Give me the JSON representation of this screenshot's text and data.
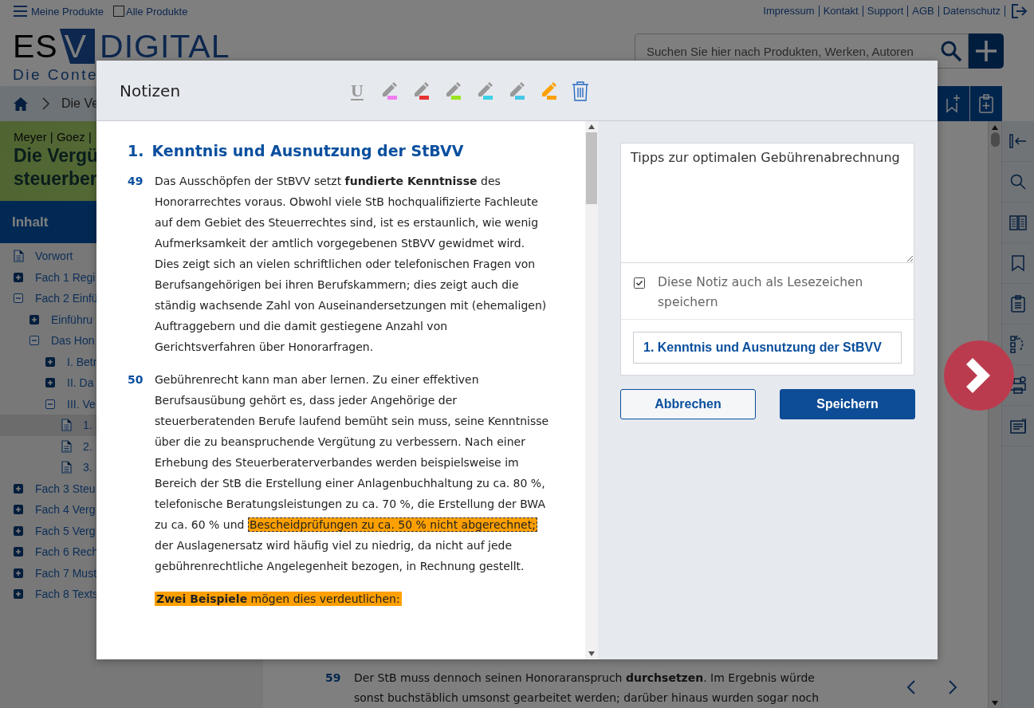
{
  "top_bar": {
    "menu_label": "Meine Produkte",
    "all_products": {
      "label": "Alle Produkte",
      "checked": false
    },
    "links": [
      "Impressum",
      "Kontakt",
      "Support",
      "AGB",
      "Datenschutz"
    ]
  },
  "logo": {
    "left": "ES",
    "mark": "V",
    "right": "DIGITAL",
    "tagline": "Die Conte"
  },
  "search": {
    "placeholder": "Suchen Sie hier nach Produkten, Werken, Autoren"
  },
  "breadcrumb": [
    "Die Ve"
  ],
  "book": {
    "authors": "Meyer | Goez |",
    "title_lines": [
      "Die Vergü",
      "steuerber"
    ]
  },
  "toc": {
    "title": "Inhalt",
    "items": [
      {
        "kind": "doc",
        "label": "Vorwort",
        "selected": false
      },
      {
        "kind": "folder",
        "label": "Fach 1 Regi",
        "expanded": false,
        "selected": false
      },
      {
        "kind": "folder",
        "label": "Fach 2 Einfü",
        "expanded": true,
        "selected": false,
        "children": [
          {
            "kind": "folder",
            "label": "Einführu",
            "expanded": false,
            "selected": false
          },
          {
            "kind": "folder",
            "label": "Das Hon",
            "expanded": true,
            "selected": false,
            "children": [
              {
                "kind": "folder",
                "label": "I. Betr",
                "expanded": false,
                "selected": false
              },
              {
                "kind": "folder",
                "label": "II. Da",
                "expanded": false,
                "selected": false
              },
              {
                "kind": "folder",
                "label": "III. Ve",
                "expanded": true,
                "selected": false,
                "children": [
                  {
                    "kind": "doc",
                    "label": "1.",
                    "selected": true
                  },
                  {
                    "kind": "doc",
                    "label": "2.",
                    "selected": false
                  },
                  {
                    "kind": "doc",
                    "label": "3.",
                    "selected": false
                  }
                ]
              }
            ]
          }
        ]
      },
      {
        "kind": "folder",
        "label": "Fach 3 Steu",
        "expanded": false,
        "selected": false
      },
      {
        "kind": "folder",
        "label": "Fach 4 Verg",
        "expanded": false,
        "selected": false
      },
      {
        "kind": "folder",
        "label": "Fach 5 Verg",
        "expanded": false,
        "selected": false
      },
      {
        "kind": "folder",
        "label": "Fach 6 Rech",
        "expanded": false,
        "selected": false
      },
      {
        "kind": "folder",
        "label": "Fach 7 Must",
        "expanded": false,
        "selected": false
      },
      {
        "kind": "folder",
        "label": "Fach 8 Texts",
        "expanded": false,
        "selected": false
      }
    ]
  },
  "content": {
    "number": "59",
    "text": "Der StB muss dennoch seinen Honoraranspruch **durchsetzen**. Im Ergebnis würde sonst buchstäblich umsonst gearbeitet werden; darüber hinaus wurden sogar noch"
  },
  "dialog": {
    "title": "Notizen",
    "underline_label": "U",
    "highlighters": [
      {
        "color": "#f07ef0",
        "selected": false
      },
      {
        "color": "#e83232",
        "selected": false
      },
      {
        "color": "#9be61c",
        "selected": false
      },
      {
        "color": "#3cd2e6",
        "selected": false
      },
      {
        "color": "#46c8e8",
        "selected": false
      },
      {
        "color": "#ffa000",
        "selected": true
      }
    ],
    "heading": {
      "number": "1.",
      "title": "Kenntnis und Ausnutzung der StBVV"
    },
    "paragraphs": [
      {
        "number": "49",
        "segments": [
          {
            "text": "Das Ausschöpfen der StBVV setzt **fundierte Kenntnisse** des Honorarrechtes voraus. Obwohl viele StB hochqualifizierte Fachleute auf dem Gebiet des Steuerrechtes sind, ist es erstaunlich, wie wenig Aufmerksamkeit der amtlich vorgegebenen StBVV gewidmet wird. Dies zeigt sich an vielen schriftlichen oder telefonischen Fragen von Berufsangehörigen bei ihren Berufskammern; dies zeigt auch die ständig wachsende Zahl von Auseinandersetzungen mit (ehemaligen) Auftraggebern und die damit gestiegene Anzahl von Gerichtsverfahren über Honorarfragen."
          }
        ]
      },
      {
        "number": "50",
        "segments": [
          {
            "text": "Gebührenrecht kann man aber lernen. Zu einer effektiven Berufsausübung gehört es, dass jeder Angehörige der steuerberatenden Berufe laufend bemüht sein muss, seine Kenntnisse über die zu beanspruchende Vergütung zu verbessern. Nach einer Erhebung des Steuerberaterverbandes werden beispielsweise im Bereich der StB die Erstellung einer Anlagenbuchhaltung zu ca. 80 %, telefonische Beratungsleistungen zu ca. 70 %, die Erstellung der BWA zu ca. 60 % und "
          },
          {
            "text": "Bescheidprüfungen zu ca. 50 % nicht abgerechnet;",
            "color": "#ffa000",
            "selected": true
          },
          {
            "text": " der Auslagenersatz wird häufig viel zu niedrig, da nicht auf jede gebührenrechtliche Angelegenheit bezogen, in Rechnung gestellt."
          }
        ]
      },
      {
        "segments": [
          {
            "text": "**Zwei Beispiele**  mögen dies verdeutlichen:",
            "color": "#ffa000",
            "selected": false
          }
        ]
      }
    ],
    "note": {
      "value": "Tipps zur optimalen Gebührenabrechnung",
      "bookmark": {
        "label": "Diese Notiz auch als Lesezeichen speichern",
        "checked": true
      },
      "bookmark_title": "1. Kenntnis und Ausnutzung der StBVV"
    },
    "buttons": [
      {
        "label": "Abbrechen",
        "kind": "secondary"
      },
      {
        "label": "Speichern",
        "kind": "primary"
      }
    ]
  }
}
